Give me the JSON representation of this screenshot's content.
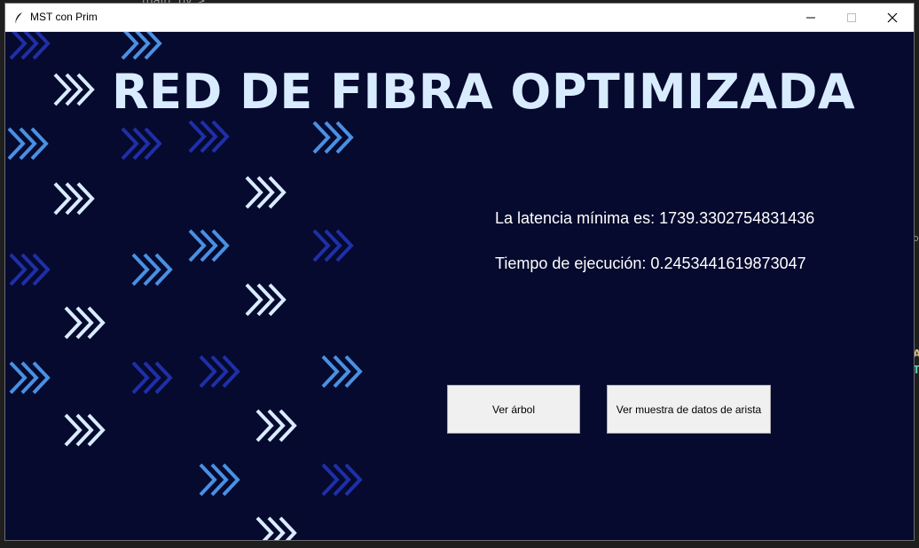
{
  "background_editor": {
    "tab_text": "main .py > ..."
  },
  "window": {
    "title": "MST con Prim",
    "icons": {
      "app": "feather-icon",
      "minimize": "minimize-icon",
      "maximize": "maximize-icon",
      "close": "close-icon"
    }
  },
  "main": {
    "heading": "RED DE FIBRA OPTIMIZADA",
    "latency_text": "La latencia mínima es: 1739.3302754831436",
    "time_text": "Tiempo de ejecución: 0.2453441619873047",
    "buttons": {
      "tree": "Ver árbol",
      "edges": "Ver muestra de datos de arista"
    }
  },
  "colors": {
    "canvas_bg": "#050a2e",
    "heading": "#d9ecff",
    "chevron_light": "#d9ecff",
    "chevron_mid": "#4a90e2",
    "chevron_dark": "#1f2fa8"
  }
}
